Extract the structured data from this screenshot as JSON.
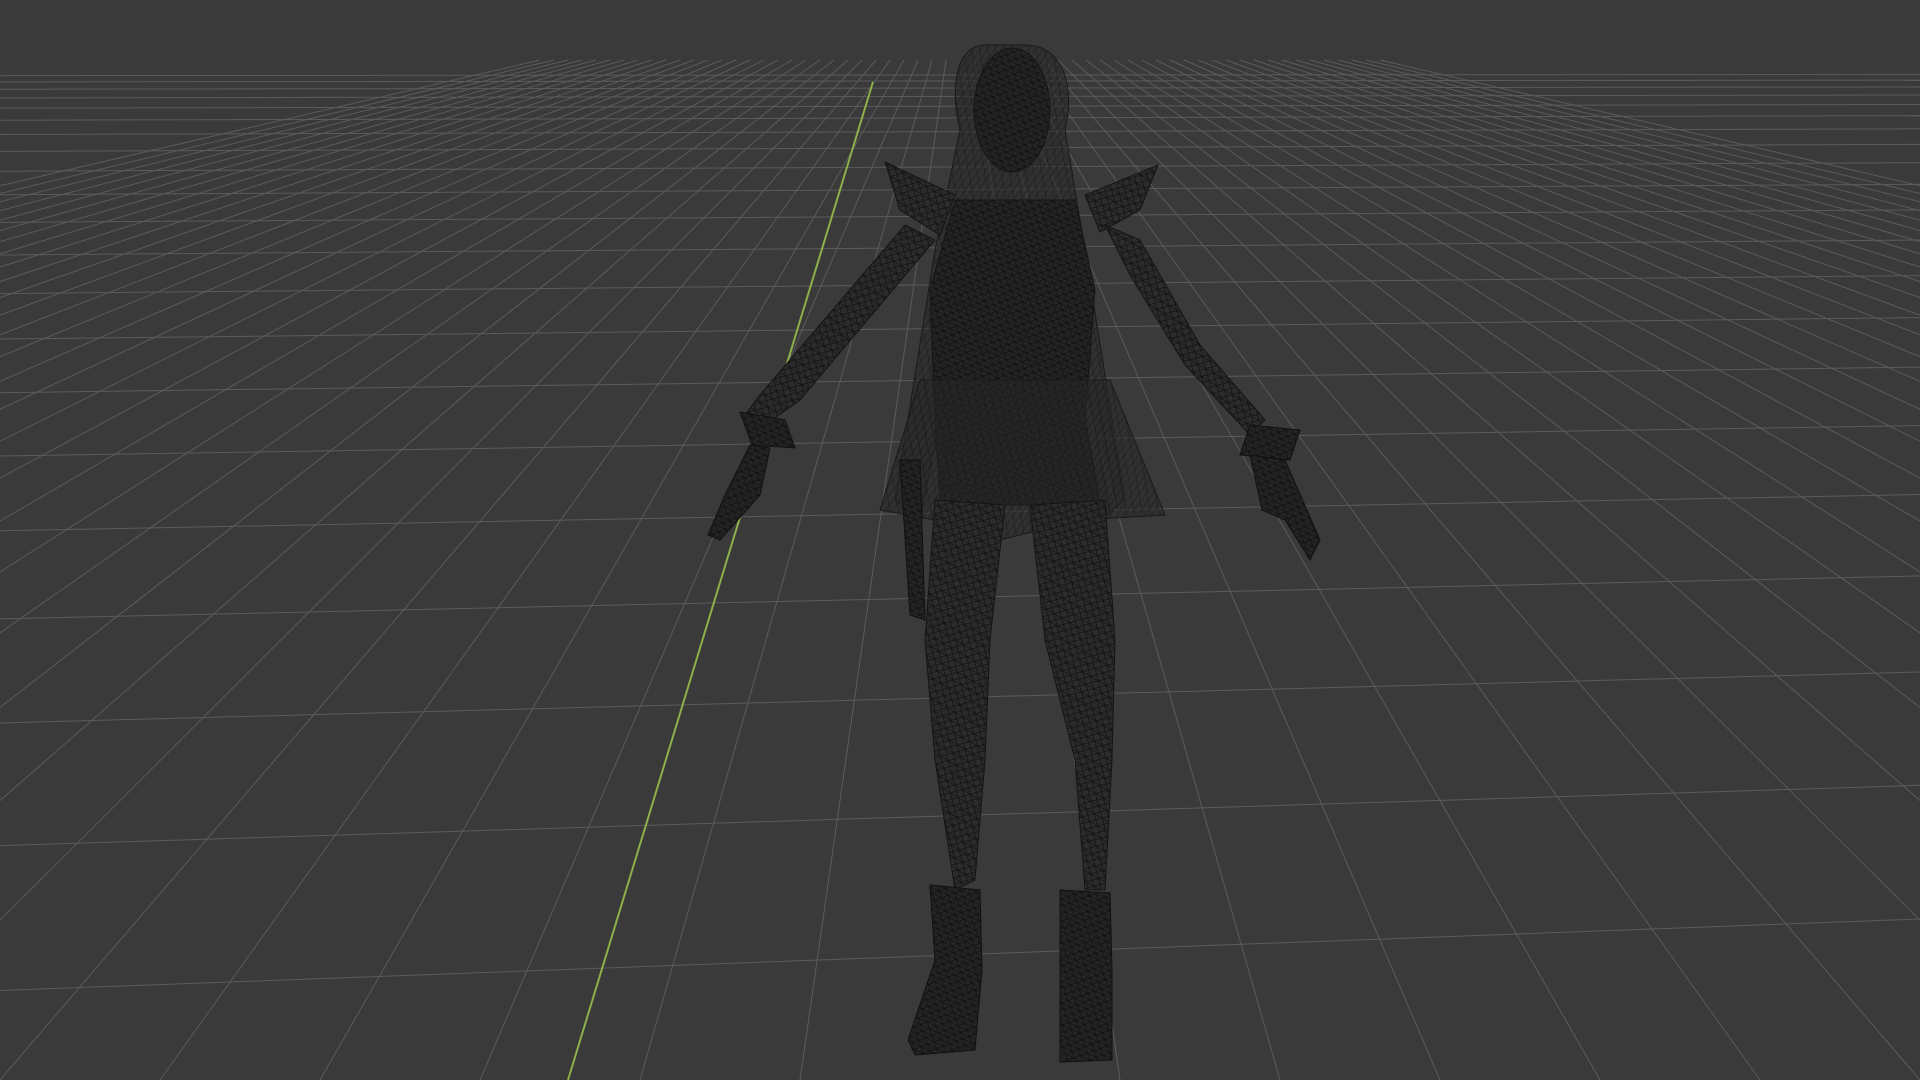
{
  "viewport": {
    "background_color": "#3a3a3a",
    "grid_color": "#5a5a5a",
    "y_axis_color": "#8cb04a",
    "mesh_color": "#1a1a1a",
    "shading_mode": "wireframe",
    "object": "character-mesh"
  }
}
